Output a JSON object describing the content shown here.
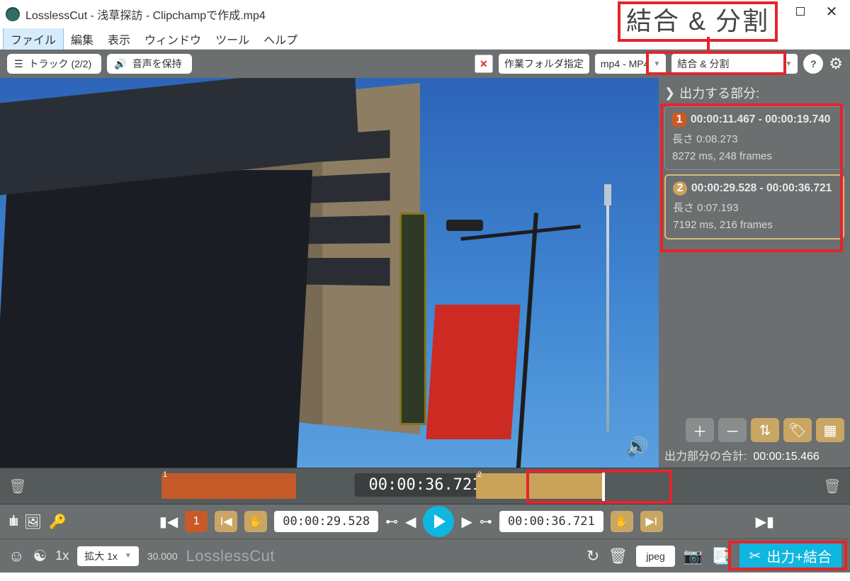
{
  "window": {
    "title": "LosslessCut - 浅草探訪 - Clipchampで作成.mp4"
  },
  "callout": "結合 & 分割",
  "menu": {
    "file": "ファイル",
    "edit": "編集",
    "view": "表示",
    "window": "ウィンドウ",
    "tools": "ツール",
    "help": "ヘルプ"
  },
  "toolbar": {
    "tracks": "トラック (2/2)",
    "keep_audio": "音声を保持",
    "work_folder": "作業フォルダ指定",
    "format": "mp4 - MP4",
    "mode": "結合 & 分割"
  },
  "side": {
    "header": "出力する部分:",
    "segments": [
      {
        "num": "1",
        "range": "00:00:11.467 - 00:00:19.740",
        "length": "長さ 0:08.273",
        "detail": "8272 ms, 248 frames"
      },
      {
        "num": "2",
        "range": "00:00:29.528 - 00:00:36.721",
        "length": "長さ 0:07.193",
        "detail": "7192 ms, 216 frames"
      }
    ],
    "total_label": "出力部分の合計:",
    "total_value": "00:00:15.466"
  },
  "timeline": {
    "center_time": "00:00:36.721",
    "clip1": "1",
    "clip2": "2"
  },
  "controls": {
    "seg_num": "1",
    "in_time": "00:00:29.528",
    "out_time": "00:00:36.721"
  },
  "bottom": {
    "speed": "1x",
    "zoom_label": "拡大 1x",
    "fps": "30.000",
    "brand": "LosslessCut",
    "snapshot_fmt": "jpeg",
    "export": "出力+結合"
  }
}
